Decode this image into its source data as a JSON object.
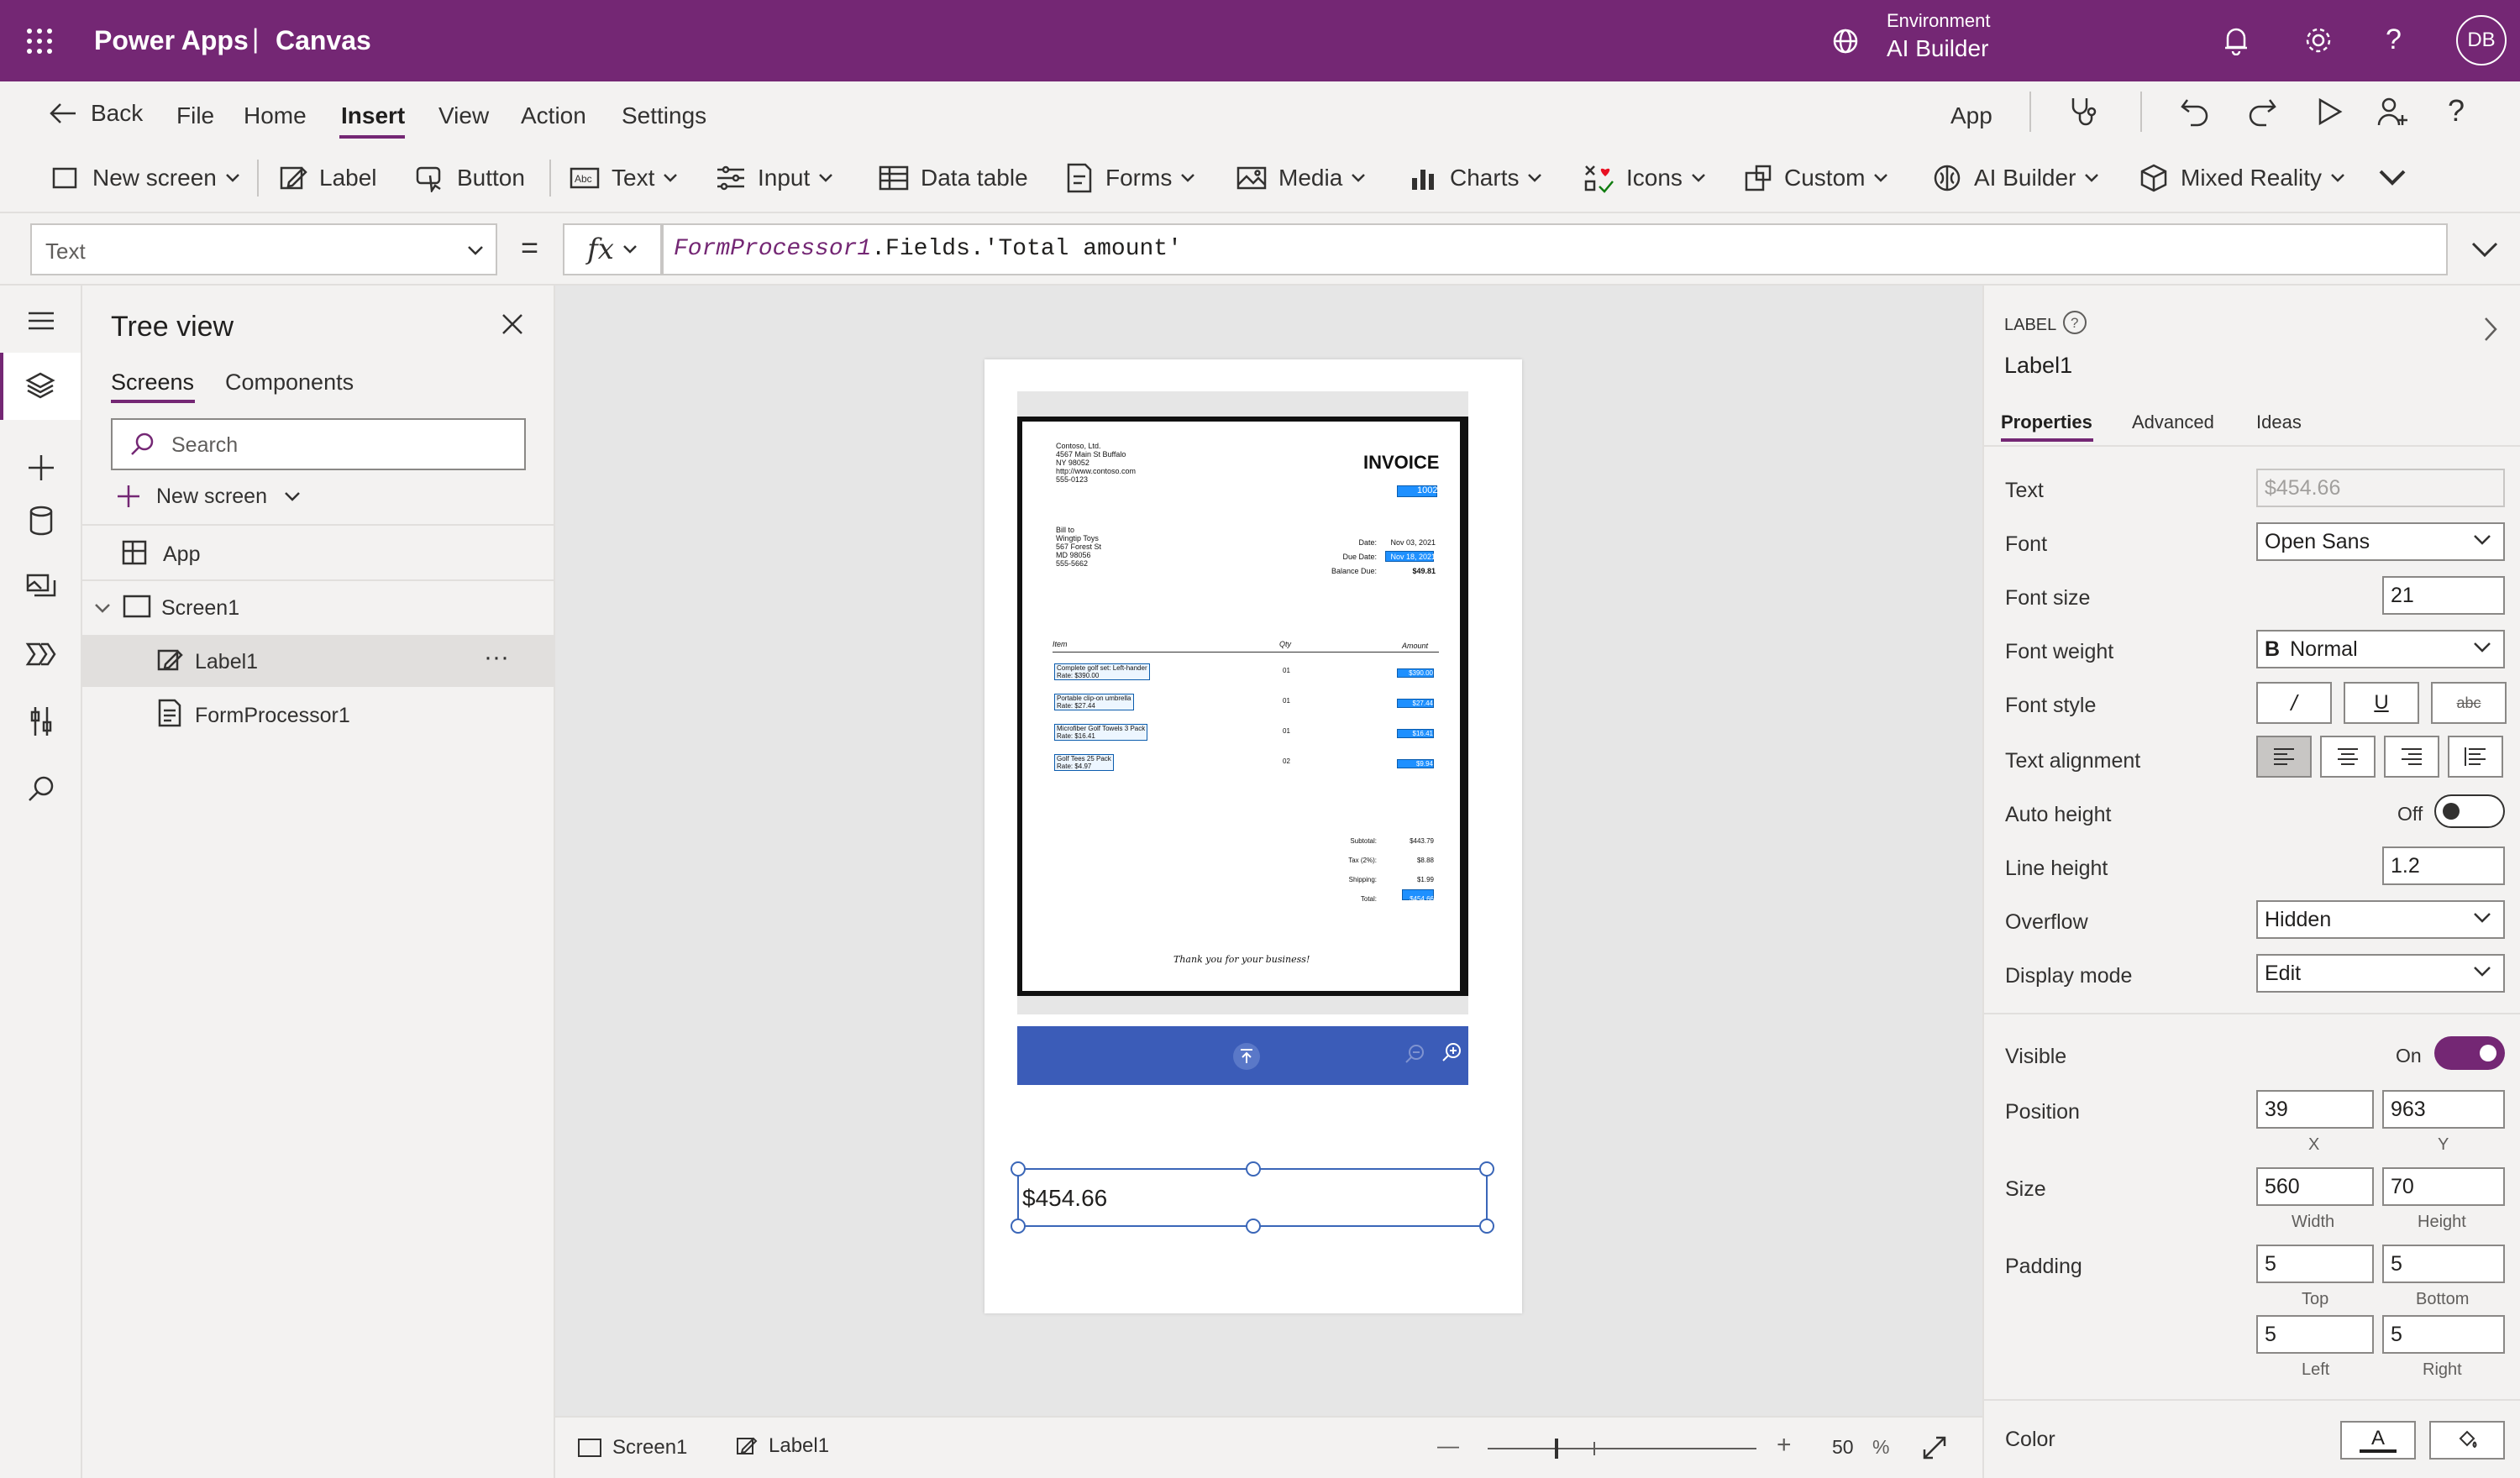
{
  "app": {
    "name": "Power Apps",
    "mode": "Canvas",
    "env_label": "Environment",
    "env_name": "AI Builder",
    "user_initials": "DB"
  },
  "menu": {
    "back": "Back",
    "items": [
      "File",
      "Home",
      "Insert",
      "View",
      "Action",
      "Settings"
    ],
    "active": "Insert",
    "app": "App"
  },
  "ribbon": {
    "new_screen": "New screen",
    "label": "Label",
    "button": "Button",
    "text": "Text",
    "input": "Input",
    "data_table": "Data table",
    "forms": "Forms",
    "media": "Media",
    "charts": "Charts",
    "icons": "Icons",
    "custom": "Custom",
    "ai_builder": "AI Builder",
    "mixed_reality": "Mixed Reality"
  },
  "formula": {
    "property": "Text",
    "equals": "=",
    "fx": "fx",
    "object": "FormProcessor1",
    "expr": ".Fields.'Total amount'"
  },
  "tree": {
    "title": "Tree view",
    "tabs": [
      "Screens",
      "Components"
    ],
    "search_placeholder": "Search",
    "new_screen": "New screen",
    "app": "App",
    "screen": "Screen1",
    "label": "Label1",
    "formprocessor": "FormProcessor1",
    "more": "···"
  },
  "invoice": {
    "company": [
      "Contoso, Ltd.",
      "4567 Main St Buffalo",
      "NY 98052",
      "http://www.contoso.com",
      "555-0123"
    ],
    "title": "INVOICE",
    "number": "1002",
    "bill_to": [
      "Bill to",
      "Wingtip Toys",
      "567 Forest St",
      "MD 98056",
      "555-5662"
    ],
    "date_labels": [
      "Date:",
      "Due Date:",
      "Balance Due:"
    ],
    "date_values": [
      "Nov 03, 2021",
      "Nov 18, 2021",
      "$49.81"
    ],
    "col_item": "Item",
    "col_qty": "Qty",
    "col_amount": "Amount",
    "items": [
      {
        "name": "Complete golf set: Left-hander",
        "rate": "Rate: $390.00",
        "qty": "01",
        "amount": "$390.00"
      },
      {
        "name": "Portable clip-on umbrella",
        "rate": "Rate: $27.44",
        "qty": "01",
        "amount": "$27.44"
      },
      {
        "name": "Microfiber Golf Towels 3 Pack",
        "rate": "Rate: $16.41",
        "qty": "01",
        "amount": "$16.41"
      },
      {
        "name": "Golf Tees 25 Pack",
        "rate": "Rate: $4.97",
        "qty": "02",
        "amount": "$9.94"
      }
    ],
    "totals_labels": [
      "Subtotal:",
      "Tax (2%):",
      "Shipping:",
      "Total:"
    ],
    "totals_values": [
      "$443.79",
      "$8.88",
      "$1.99",
      "$454.66"
    ],
    "thanks": "Thank you for your business!"
  },
  "label_value": "$454.66",
  "status": {
    "screen": "Screen1",
    "label": "Label1",
    "zoom": "50",
    "percent": "%",
    "minus": "—",
    "plus": "+"
  },
  "props": {
    "type": "LABEL",
    "name": "Label1",
    "tabs": [
      "Properties",
      "Advanced",
      "Ideas"
    ],
    "text_label": "Text",
    "text_value": "$454.66",
    "font_label": "Font",
    "font_value": "Open Sans",
    "font_size_label": "Font size",
    "font_size": "21",
    "font_weight_label": "Font weight",
    "font_weight_icon": "B",
    "font_weight": "Normal",
    "font_style_label": "Font style",
    "italic": "/",
    "underline": "U",
    "strike": "abc",
    "text_align_label": "Text alignment",
    "auto_height_label": "Auto height",
    "auto_height": "Off",
    "line_height_label": "Line height",
    "line_height": "1.2",
    "overflow_label": "Overflow",
    "overflow": "Hidden",
    "display_mode_label": "Display mode",
    "display_mode": "Edit",
    "visible_label": "Visible",
    "visible": "On",
    "position_label": "Position",
    "x": "39",
    "y": "963",
    "x_cap": "X",
    "y_cap": "Y",
    "size_label": "Size",
    "width": "560",
    "height": "70",
    "w_cap": "Width",
    "h_cap": "Height",
    "padding_label": "Padding",
    "pad_top": "5",
    "pad_bottom": "5",
    "pad_left": "5",
    "pad_right": "5",
    "top_cap": "Top",
    "bottom_cap": "Bottom",
    "left_cap": "Left",
    "right_cap": "Right",
    "color_label": "Color",
    "color_glyph": "A"
  },
  "colors": {
    "brand": "#742774",
    "selection": "#3a66b8",
    "toggle_on": "#742774",
    "viewer_bar": "#3b5cb8",
    "highlight": "#1e90ff"
  }
}
